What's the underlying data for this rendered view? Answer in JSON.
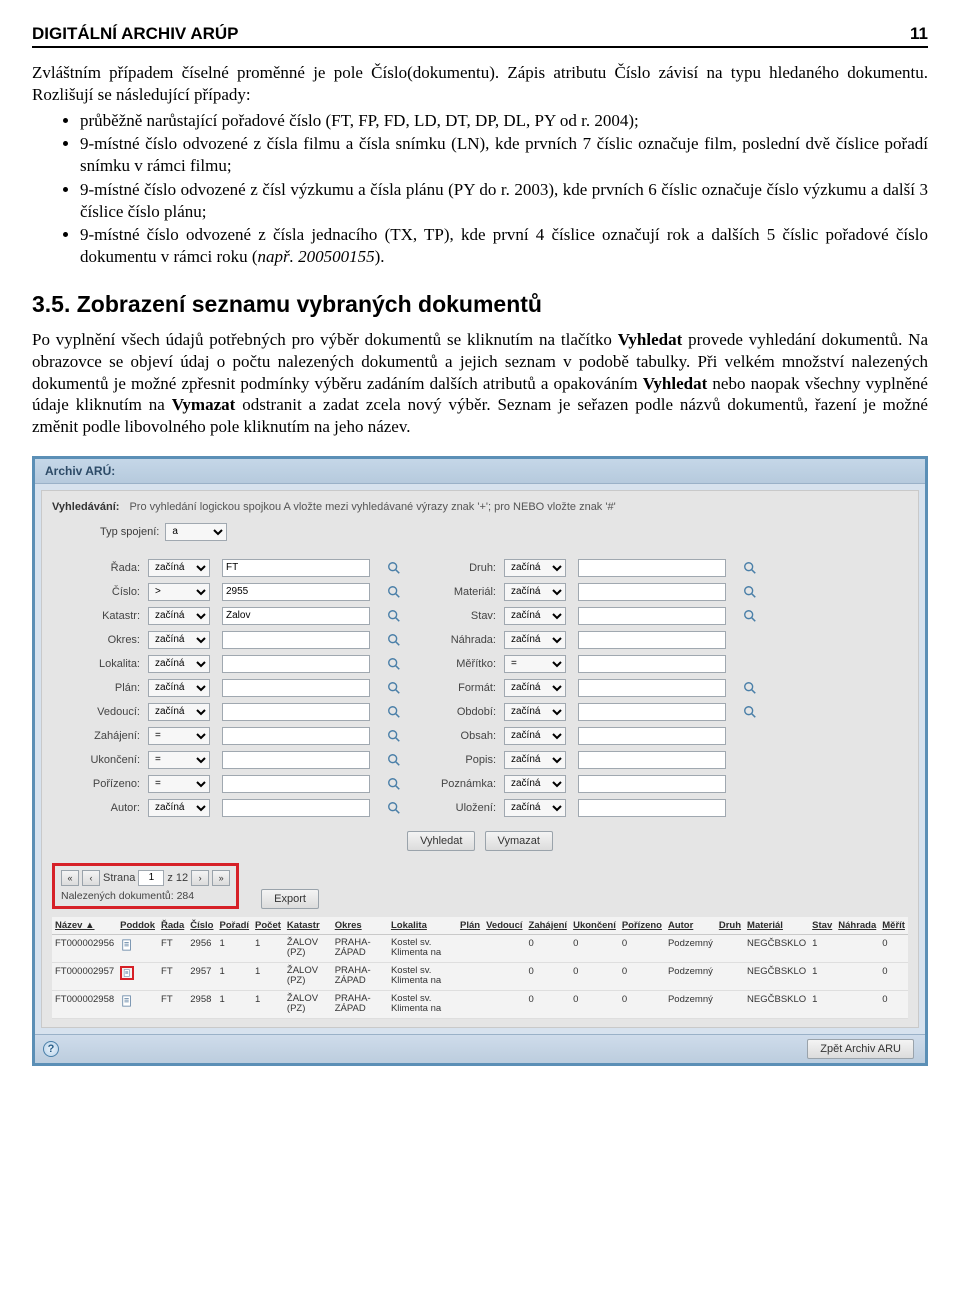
{
  "header": {
    "title": "DIGITÁLNÍ ARCHIV ARÚP",
    "page_no": "11"
  },
  "para1": "Zvláštním případem číselné proměnné je pole Číslo(dokumentu). Zápis atributu Číslo závisí na typu hledaného dokumentu. Rozlišují se následující případy:",
  "bullets": {
    "b0": "průběžně narůstající pořadové číslo (FT, FP, FD, LD, DT, DP, DL, PY od r. 2004);",
    "b1": "9-místné číslo odvozené z čísla filmu a čísla snímku (LN), kde prvních 7 číslic označuje film, poslední dvě číslice pořadí snímku v rámci filmu;",
    "b2": "9-místné číslo odvozené z čísl výzkumu a čísla plánu (PY do r. 2003), kde prvních 6 číslic označuje číslo výzkumu a další 3 číslice číslo plánu;",
    "b3_a": "9-místné číslo odvozené z čísla jednacího (TX, TP), kde první 4 číslice označují rok a dalších 5 číslic pořadové číslo dokumentu v rámci roku (",
    "b3_i": "např. 200500155",
    "b3_b": ")."
  },
  "section_heading": "3.5. Zobrazení seznamu vybraných dokumentů",
  "para2_a": "Po vyplnění všech údajů potřebných pro výběr dokumentů se kliknutím na tlačítko ",
  "para2_b": "Vyhledat",
  "para2_c": " provede vyhledání dokumentů. Na obrazovce se objeví údaj o počtu nalezených dokumentů a jejich seznam v podobě tabulky. Při velkém množství nalezených dokumentů je možné zpřesnit podmínky výběru zadáním dalších atributů a opakováním ",
  "para2_d": "Vyhledat",
  "para2_e": " nebo naopak všechny vyplněné údaje kliknutím na ",
  "para2_f": "Vymazat",
  "para2_g": " odstranit a zadat zcela nový výběr. Seznam je seřazen podle názvů dokumentů, řazení je možné změnit podle libovolného pole kliknutím na jeho název.",
  "shot": {
    "titlebar": "Archiv ARÚ:",
    "search_label": "Vyhledávání:",
    "search_hint": "Pro vyhledání logickou spojkou A vložte mezi vyhledávané výrazy znak '+'; pro NEBO vložte znak '#'",
    "typ_label": "Typ spojení:",
    "typ_value": "a",
    "ops": {
      "zacina": "začíná",
      "eq": "=",
      "gt": ">"
    },
    "left_rows": [
      {
        "label": "Řada:",
        "op": "začíná",
        "val": "FT"
      },
      {
        "label": "Číslo:",
        "op": ">",
        "val": "2955"
      },
      {
        "label": "Katastr:",
        "op": "začíná",
        "val": "Žalov"
      },
      {
        "label": "Okres:",
        "op": "začíná",
        "val": ""
      },
      {
        "label": "Lokalita:",
        "op": "začíná",
        "val": ""
      },
      {
        "label": "Plán:",
        "op": "začíná",
        "val": ""
      },
      {
        "label": "Vedoucí:",
        "op": "začíná",
        "val": ""
      },
      {
        "label": "Zahájení:",
        "op": "=",
        "val": ""
      },
      {
        "label": "Ukončení:",
        "op": "=",
        "val": ""
      },
      {
        "label": "Pořízeno:",
        "op": "=",
        "val": ""
      },
      {
        "label": "Autor:",
        "op": "začíná",
        "val": ""
      }
    ],
    "right_rows": [
      {
        "label": "Druh:",
        "op": "začíná",
        "has_mag": true
      },
      {
        "label": "Materiál:",
        "op": "začíná",
        "has_mag": true
      },
      {
        "label": "Stav:",
        "op": "začíná",
        "has_mag": true
      },
      {
        "label": "Náhrada:",
        "op": "začíná",
        "has_mag": false
      },
      {
        "label": "Měřítko:",
        "op": "=",
        "has_mag": false
      },
      {
        "label": "Formát:",
        "op": "začíná",
        "has_mag": true
      },
      {
        "label": "Období:",
        "op": "začíná",
        "has_mag": true
      },
      {
        "label": "Obsah:",
        "op": "začíná",
        "has_mag": false
      },
      {
        "label": "Popis:",
        "op": "začíná",
        "has_mag": false
      },
      {
        "label": "Poznámka:",
        "op": "začíná",
        "has_mag": false
      },
      {
        "label": "Uložení:",
        "op": "začíná",
        "has_mag": false
      }
    ],
    "btn_search": "Vyhledat",
    "btn_clear": "Vymazat",
    "pager": {
      "page_label": "Strana",
      "page": "1",
      "of_label": "z",
      "total": "12"
    },
    "found_label": "Nalezených dokumentů:",
    "found_count": "284",
    "export_label": "Export",
    "columns": [
      "Název ▲",
      "Poddok",
      "Řada",
      "Číslo",
      "Pořadí",
      "Počet",
      "Katastr",
      "Okres",
      "Lokalita",
      "Plán",
      "Vedoucí",
      "Zahájení",
      "Ukončení",
      "Pořízeno",
      "Autor",
      "Druh",
      "Materiál",
      "Stav",
      "Náhrada",
      "Měřít"
    ],
    "rows": [
      {
        "nazev": "FT000002956",
        "rada": "FT",
        "cislo": "2956",
        "poradi": "1",
        "pocet": "1",
        "katastr": "ŽALOV (PZ)",
        "okres": "PRAHA-ZÁPAD",
        "lokalita": "Kostel sv. Klimenta na",
        "zahaj": "0",
        "ukon": "0",
        "poriz": "0",
        "autor": "Podzemný",
        "druh": "",
        "material": "NEGČBSKLO",
        "stav": "1",
        "merit": "0",
        "red": false
      },
      {
        "nazev": "FT000002957",
        "rada": "FT",
        "cislo": "2957",
        "poradi": "1",
        "pocet": "1",
        "katastr": "ŽALOV (PZ)",
        "okres": "PRAHA-ZÁPAD",
        "lokalita": "Kostel sv. Klimenta na",
        "zahaj": "0",
        "ukon": "0",
        "poriz": "0",
        "autor": "Podzemný",
        "druh": "",
        "material": "NEGČBSKLO",
        "stav": "1",
        "merit": "0",
        "red": true
      },
      {
        "nazev": "FT000002958",
        "rada": "FT",
        "cislo": "2958",
        "poradi": "1",
        "pocet": "1",
        "katastr": "ŽALOV (PZ)",
        "okres": "PRAHA-ZÁPAD",
        "lokalita": "Kostel sv. Klimenta na",
        "zahaj": "0",
        "ukon": "0",
        "poriz": "0",
        "autor": "Podzemný",
        "druh": "",
        "material": "NEGČBSKLO",
        "stav": "1",
        "merit": "0",
        "red": false
      }
    ],
    "back_btn": "Zpět Archiv ARU"
  }
}
